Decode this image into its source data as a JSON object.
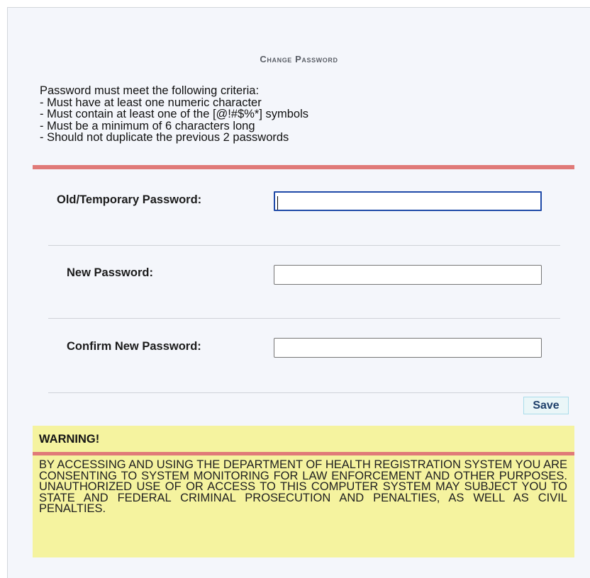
{
  "page": {
    "title": "Change Password"
  },
  "criteria": {
    "intro": "Password must meet the following criteria:",
    "rules": [
      "- Must have at least one numeric character",
      "- Must contain at least one of the [@!#$%*] symbols",
      "- Must be a minimum of 6 characters long",
      "- Should not duplicate the previous 2 passwords"
    ]
  },
  "form": {
    "old_password": {
      "label": "Old/Temporary Password:",
      "value": "",
      "focused": true
    },
    "new_password": {
      "label": "New Password:",
      "value": ""
    },
    "confirm_password": {
      "label": "Confirm New Password:",
      "value": ""
    },
    "save_label": "Save"
  },
  "warning": {
    "title": "WARNING!",
    "text": "BY ACCESSING AND USING THE DEPARTMENT OF HEALTH REGISTRATION SYSTEM YOU ARE CONSENTING TO SYSTEM MONITORING FOR LAW ENFORCEMENT AND OTHER PURPOSES. UNAUTHORIZED USE OF OR ACCESS TO THIS COMPUTER SYSTEM MAY SUBJECT YOU TO STATE AND FEDERAL CRIMINAL PROSECUTION AND PENALTIES, AS WELL AS CIVIL PENALTIES."
  },
  "colors": {
    "accent_rule": "#e07a78",
    "warning_background": "#f5f39f",
    "panel_background": "#f4f6fb",
    "focus_border": "#1f4aa8"
  }
}
